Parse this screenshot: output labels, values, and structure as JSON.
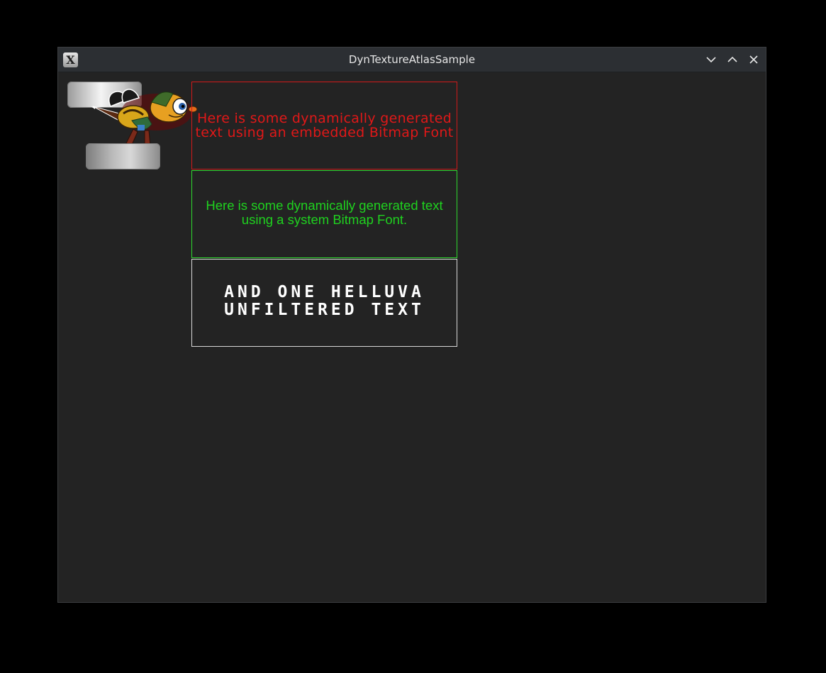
{
  "window": {
    "title": "DynTextureAtlasSample",
    "app_icon_glyph": "X",
    "controls": [
      "minimize-icon",
      "maximize-icon",
      "close-icon"
    ]
  },
  "canvas": {
    "sprites": [
      "button-bar-top",
      "bee-character",
      "button-bar-bottom"
    ],
    "text_boxes": [
      {
        "text": "Here is some dynamically generated text using an embedded Bitmap Font",
        "color": "#e01818"
      },
      {
        "text": "Here is some dynamically generated text using a system Bitmap Font.",
        "color": "#1fd11f"
      },
      {
        "text": "AND ONE HELLUVA UNFILTERED TEXT",
        "color": "#ffffff"
      }
    ]
  },
  "colors": {
    "screen_bg": "#000000",
    "window_bg": "#232323",
    "titlebar_bg": "#2c2f33",
    "red_border": "#d11a1a",
    "green_border": "#2ed82e",
    "white_border": "#d8d8d8"
  }
}
